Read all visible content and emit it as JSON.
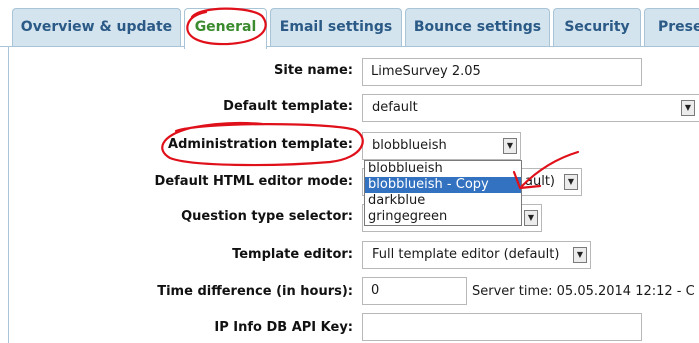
{
  "tabs": [
    {
      "label": "Overview & update"
    },
    {
      "label": "General"
    },
    {
      "label": "Email settings"
    },
    {
      "label": "Bounce settings"
    },
    {
      "label": "Security"
    },
    {
      "label": "Prese"
    }
  ],
  "active_tab": "General",
  "form": {
    "site_name": {
      "label": "Site name:",
      "value": "LimeSurvey 2.05"
    },
    "default_template": {
      "label": "Default template:",
      "value": "default"
    },
    "admin_template": {
      "label": "Administration template:",
      "value": "blobblueish",
      "options": [
        "blobblueish",
        "blobblueish - Copy",
        "darkblue",
        "gringegreen"
      ],
      "highlighted_option": "blobblueish - Copy"
    },
    "html_editor_mode": {
      "label": "Default HTML editor mode:",
      "value_fragment": "ault)"
    },
    "question_type_selector": {
      "label": "Question type selector:"
    },
    "template_editor": {
      "label": "Template editor:",
      "value": "Full template editor (default)"
    },
    "time_difference": {
      "label": "Time difference (in hours):",
      "value": "0",
      "server_time": "Server time: 05.05.2014 12:12 - C"
    },
    "ip_info_key": {
      "label": "IP Info DB API Key:",
      "value": ""
    }
  },
  "icons": {
    "dropdown_arrow": "▼"
  },
  "colors": {
    "tab_bg": "#d3e4ef",
    "tab_text": "#2b5a86",
    "active_tab_text": "#3a8a2e",
    "highlight": "#3272c0",
    "annotation": "#e0101a"
  }
}
